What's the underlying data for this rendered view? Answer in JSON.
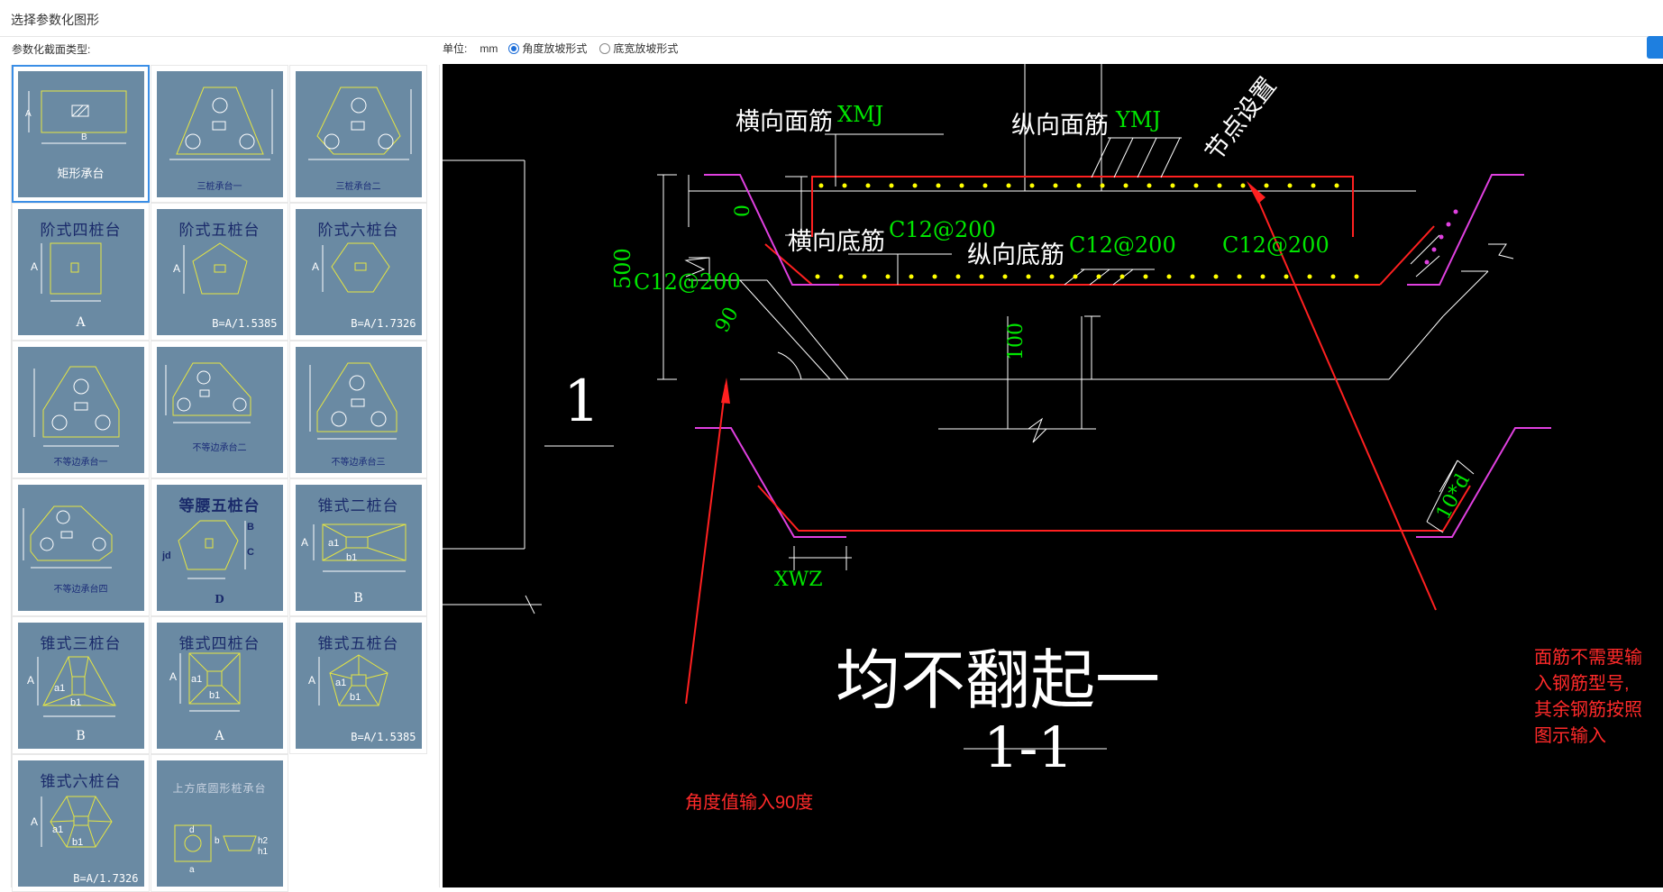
{
  "window": {
    "title": "选择参数化图形"
  },
  "toolbar": {
    "type_label": "参数化截面类型:",
    "unit_label": "单位:",
    "unit_value": "mm",
    "radio_angle": "角度放坡形式",
    "radio_width": "底宽放坡形式",
    "selected_mode": "角度放坡形式"
  },
  "shapes": [
    {
      "title": "",
      "caption": "矩形承台",
      "selected": true
    },
    {
      "title": "",
      "caption": "三桩承台一"
    },
    {
      "title": "",
      "caption": "三桩承台二"
    },
    {
      "title": "阶式四桩台",
      "caption": "A"
    },
    {
      "title": "阶式五桩台",
      "caption": "B=A/1.5385"
    },
    {
      "title": "阶式六桩台",
      "caption": "B=A/1.7326"
    },
    {
      "title": "",
      "caption": "不等边承台一"
    },
    {
      "title": "",
      "caption": "不等边承台二"
    },
    {
      "title": "",
      "caption": "不等边承台三"
    },
    {
      "title": "",
      "caption": "不等边承台四"
    },
    {
      "title": "等腰五桩台",
      "caption": "D"
    },
    {
      "title": "锥式二桩台",
      "caption": "B"
    },
    {
      "title": "锥式三桩台",
      "caption": "B"
    },
    {
      "title": "锥式四桩台",
      "caption": "A"
    },
    {
      "title": "锥式五桩台",
      "caption": "B=A/1.5385"
    },
    {
      "title": "锥式六桩台",
      "caption": "B=A/1.7326"
    },
    {
      "title": "上方底圆形桩承台",
      "caption": ""
    }
  ],
  "drawing": {
    "labels": {
      "transverse_top": "横向面筋",
      "transverse_top_code": "XMJ",
      "longitudinal_top": "纵向面筋",
      "longitudinal_top_code": "YMJ",
      "node_setting": "节点设置",
      "transverse_bottom": "横向底筋",
      "transverse_bottom_value": "C12@200",
      "longitudinal_bottom": "纵向底筋",
      "longitudinal_bottom_value": "C12@200",
      "right_value": "C12@200",
      "left_value": "C12@200",
      "dim_500": "500",
      "dim_0": "0",
      "dim_90": "90",
      "dim_100": "100",
      "dim_10d": "10*d",
      "xwz": "XWZ",
      "section_mark": "1",
      "main_note": "均不翻起一",
      "section_title": "1-1"
    },
    "notes": {
      "angle_note": "角度值输入90度",
      "rebar_note": [
        "面筋不需要输",
        "入钢筋型号,",
        "其余钢筋按照",
        "图示输入"
      ]
    }
  },
  "colors": {
    "thumb_bg": "#6a8aa3",
    "cad_white": "#ffffff",
    "cad_green": "#00e600",
    "cad_red": "#ff2020",
    "cad_magenta": "#e040e0",
    "cad_yellow": "#ffff00",
    "accent": "#1e7fe0"
  }
}
